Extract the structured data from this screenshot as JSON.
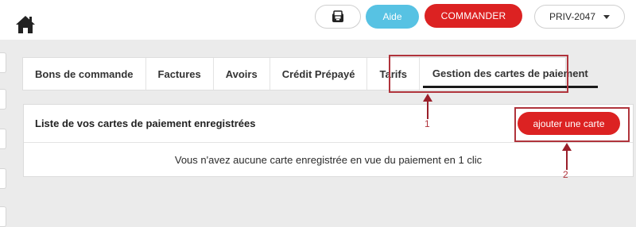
{
  "header": {
    "home_icon": "home-icon",
    "ticket_icon": "ticket-icon",
    "help_label": "Aide",
    "order_label": "COMMANDER",
    "account_code": "PRIV-2047",
    "colors": {
      "help": "#57c2e3",
      "order": "#dc2222"
    }
  },
  "tabs": [
    {
      "label": "Bons de commande",
      "active": false
    },
    {
      "label": "Factures",
      "active": false
    },
    {
      "label": "Avoirs",
      "active": false
    },
    {
      "label": "Crédit Prépayé",
      "active": false
    },
    {
      "label": "Tarifs",
      "active": false
    },
    {
      "label": "Gestion des cartes de paiement",
      "active": true
    }
  ],
  "panel": {
    "title": "Liste de vos cartes de paiement enregistrées",
    "add_button_label": "ajouter une carte",
    "empty_message": "Vous n'avez aucune carte enregistrée en vue du paiement en 1 clic"
  },
  "annotations": [
    {
      "label": "1",
      "color": "#b0343c"
    },
    {
      "label": "2",
      "color": "#b0343c"
    }
  ]
}
